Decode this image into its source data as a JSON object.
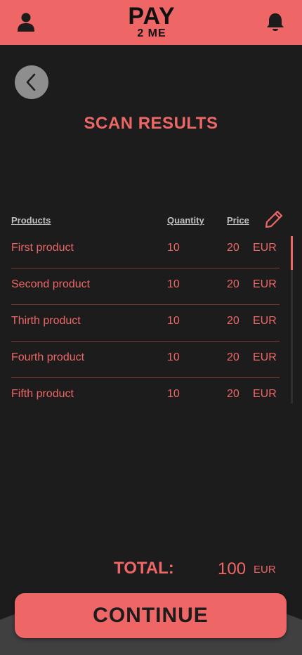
{
  "header": {
    "logo_line1": "PAY",
    "logo_line2": "2 ME",
    "user_icon": "user-icon",
    "bell_icon": "bell-icon"
  },
  "page": {
    "title": "SCAN RESULTS",
    "back_icon": "chevron-left-icon"
  },
  "table": {
    "headers": {
      "products": "Products",
      "quantity": "Quantity",
      "price": "Price"
    },
    "edit_icon": "pencil-icon",
    "rows": [
      {
        "name": "First product",
        "quantity": "10",
        "price": "20",
        "currency": "EUR"
      },
      {
        "name": "Second product",
        "quantity": "10",
        "price": "20",
        "currency": "EUR"
      },
      {
        "name": "Thirth product",
        "quantity": "10",
        "price": "20",
        "currency": "EUR"
      },
      {
        "name": "Fourth product",
        "quantity": "10",
        "price": "20",
        "currency": "EUR"
      },
      {
        "name": "Fifth product",
        "quantity": "10",
        "price": "20",
        "currency": "EUR"
      }
    ]
  },
  "total": {
    "label": "TOTAL:",
    "value": "100",
    "currency": "EUR"
  },
  "actions": {
    "continue_label": "CONTINUE"
  },
  "colors": {
    "accent": "#ee6766",
    "background": "#1c1c1c",
    "back_button": "#8e8e8e"
  }
}
